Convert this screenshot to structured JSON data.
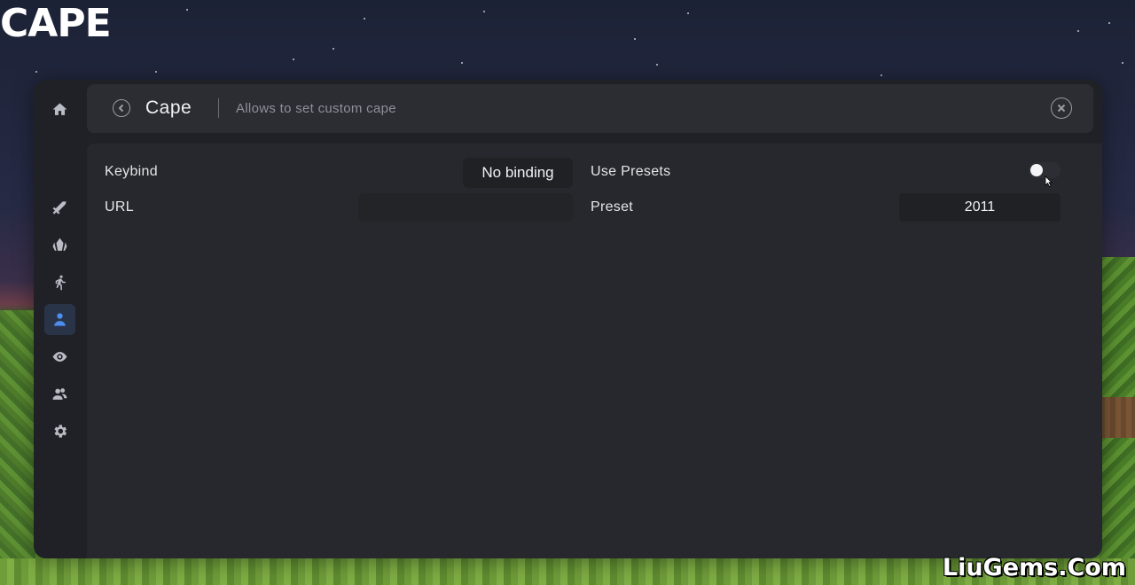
{
  "overlay": {
    "logo_text": "CAPE",
    "watermark_text": "LiuGems.Com"
  },
  "sidebar": {
    "items": [
      {
        "icon": "home-icon",
        "active": false
      },
      {
        "icon": "sword-icon",
        "active": false
      },
      {
        "icon": "crystal-icon",
        "active": false
      },
      {
        "icon": "running-person-icon",
        "active": false
      },
      {
        "icon": "user-icon",
        "active": true
      },
      {
        "icon": "eye-icon",
        "active": false
      },
      {
        "icon": "users-icon",
        "active": false
      },
      {
        "icon": "gear-icon",
        "active": false
      }
    ]
  },
  "header": {
    "title": "Cape",
    "description": "Allows to set custom cape"
  },
  "settings": {
    "keybind_label": "Keybind",
    "keybind_value": "No binding",
    "url_label": "URL",
    "url_value": "",
    "use_presets_label": "Use Presets",
    "use_presets_enabled": false,
    "preset_label": "Preset",
    "preset_value": "2011"
  },
  "colors": {
    "accent": "#4b8ef0",
    "panel_bg": "#26282d",
    "header_bg": "#2b2d33",
    "sidebar_bg": "#1f2126"
  }
}
